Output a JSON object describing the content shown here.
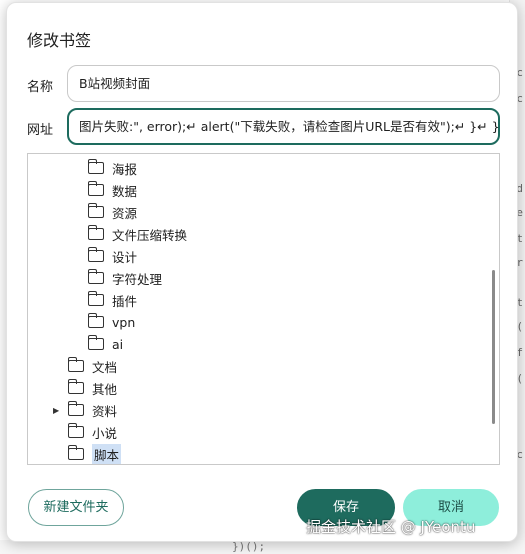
{
  "dialog": {
    "title": "修改书签",
    "name_label": "名称",
    "name_value": "B站视频封面",
    "url_label": "网址",
    "url_value": "图片失败:\", error);↵      alert(\"下载失败，请检查图片URL是否有效\");↵   }↵ })();"
  },
  "tree": {
    "items": [
      {
        "label": "海报",
        "level": 2
      },
      {
        "label": "数据",
        "level": 2
      },
      {
        "label": "资源",
        "level": 2
      },
      {
        "label": "文件压缩转换",
        "level": 2
      },
      {
        "label": "设计",
        "level": 2
      },
      {
        "label": "字符处理",
        "level": 2
      },
      {
        "label": "插件",
        "level": 2
      },
      {
        "label": "vpn",
        "level": 2
      },
      {
        "label": "ai",
        "level": 2
      },
      {
        "label": "文档",
        "level": 1
      },
      {
        "label": "其他",
        "level": 1
      },
      {
        "label": "资料",
        "level": 1,
        "collapsed": true
      },
      {
        "label": "小说",
        "level": 1
      },
      {
        "label": "脚本",
        "level": 1,
        "selected": true
      }
    ]
  },
  "buttons": {
    "new_folder": "新建文件夹",
    "save": "保存",
    "cancel": "取消"
  },
  "watermark": "掘金技术社区 @ JYeontu",
  "background": {
    "right_glyphs": [
      "c",
      "c",
      "d",
      "e",
      "t",
      "r",
      "t",
      "(",
      "f",
      "(",
      "c"
    ],
    "bottom_text": "})();"
  },
  "colors": {
    "primary": "#1e6b5e",
    "cancel_bg": "#8eeedb",
    "selection": "#cfe0f5"
  }
}
